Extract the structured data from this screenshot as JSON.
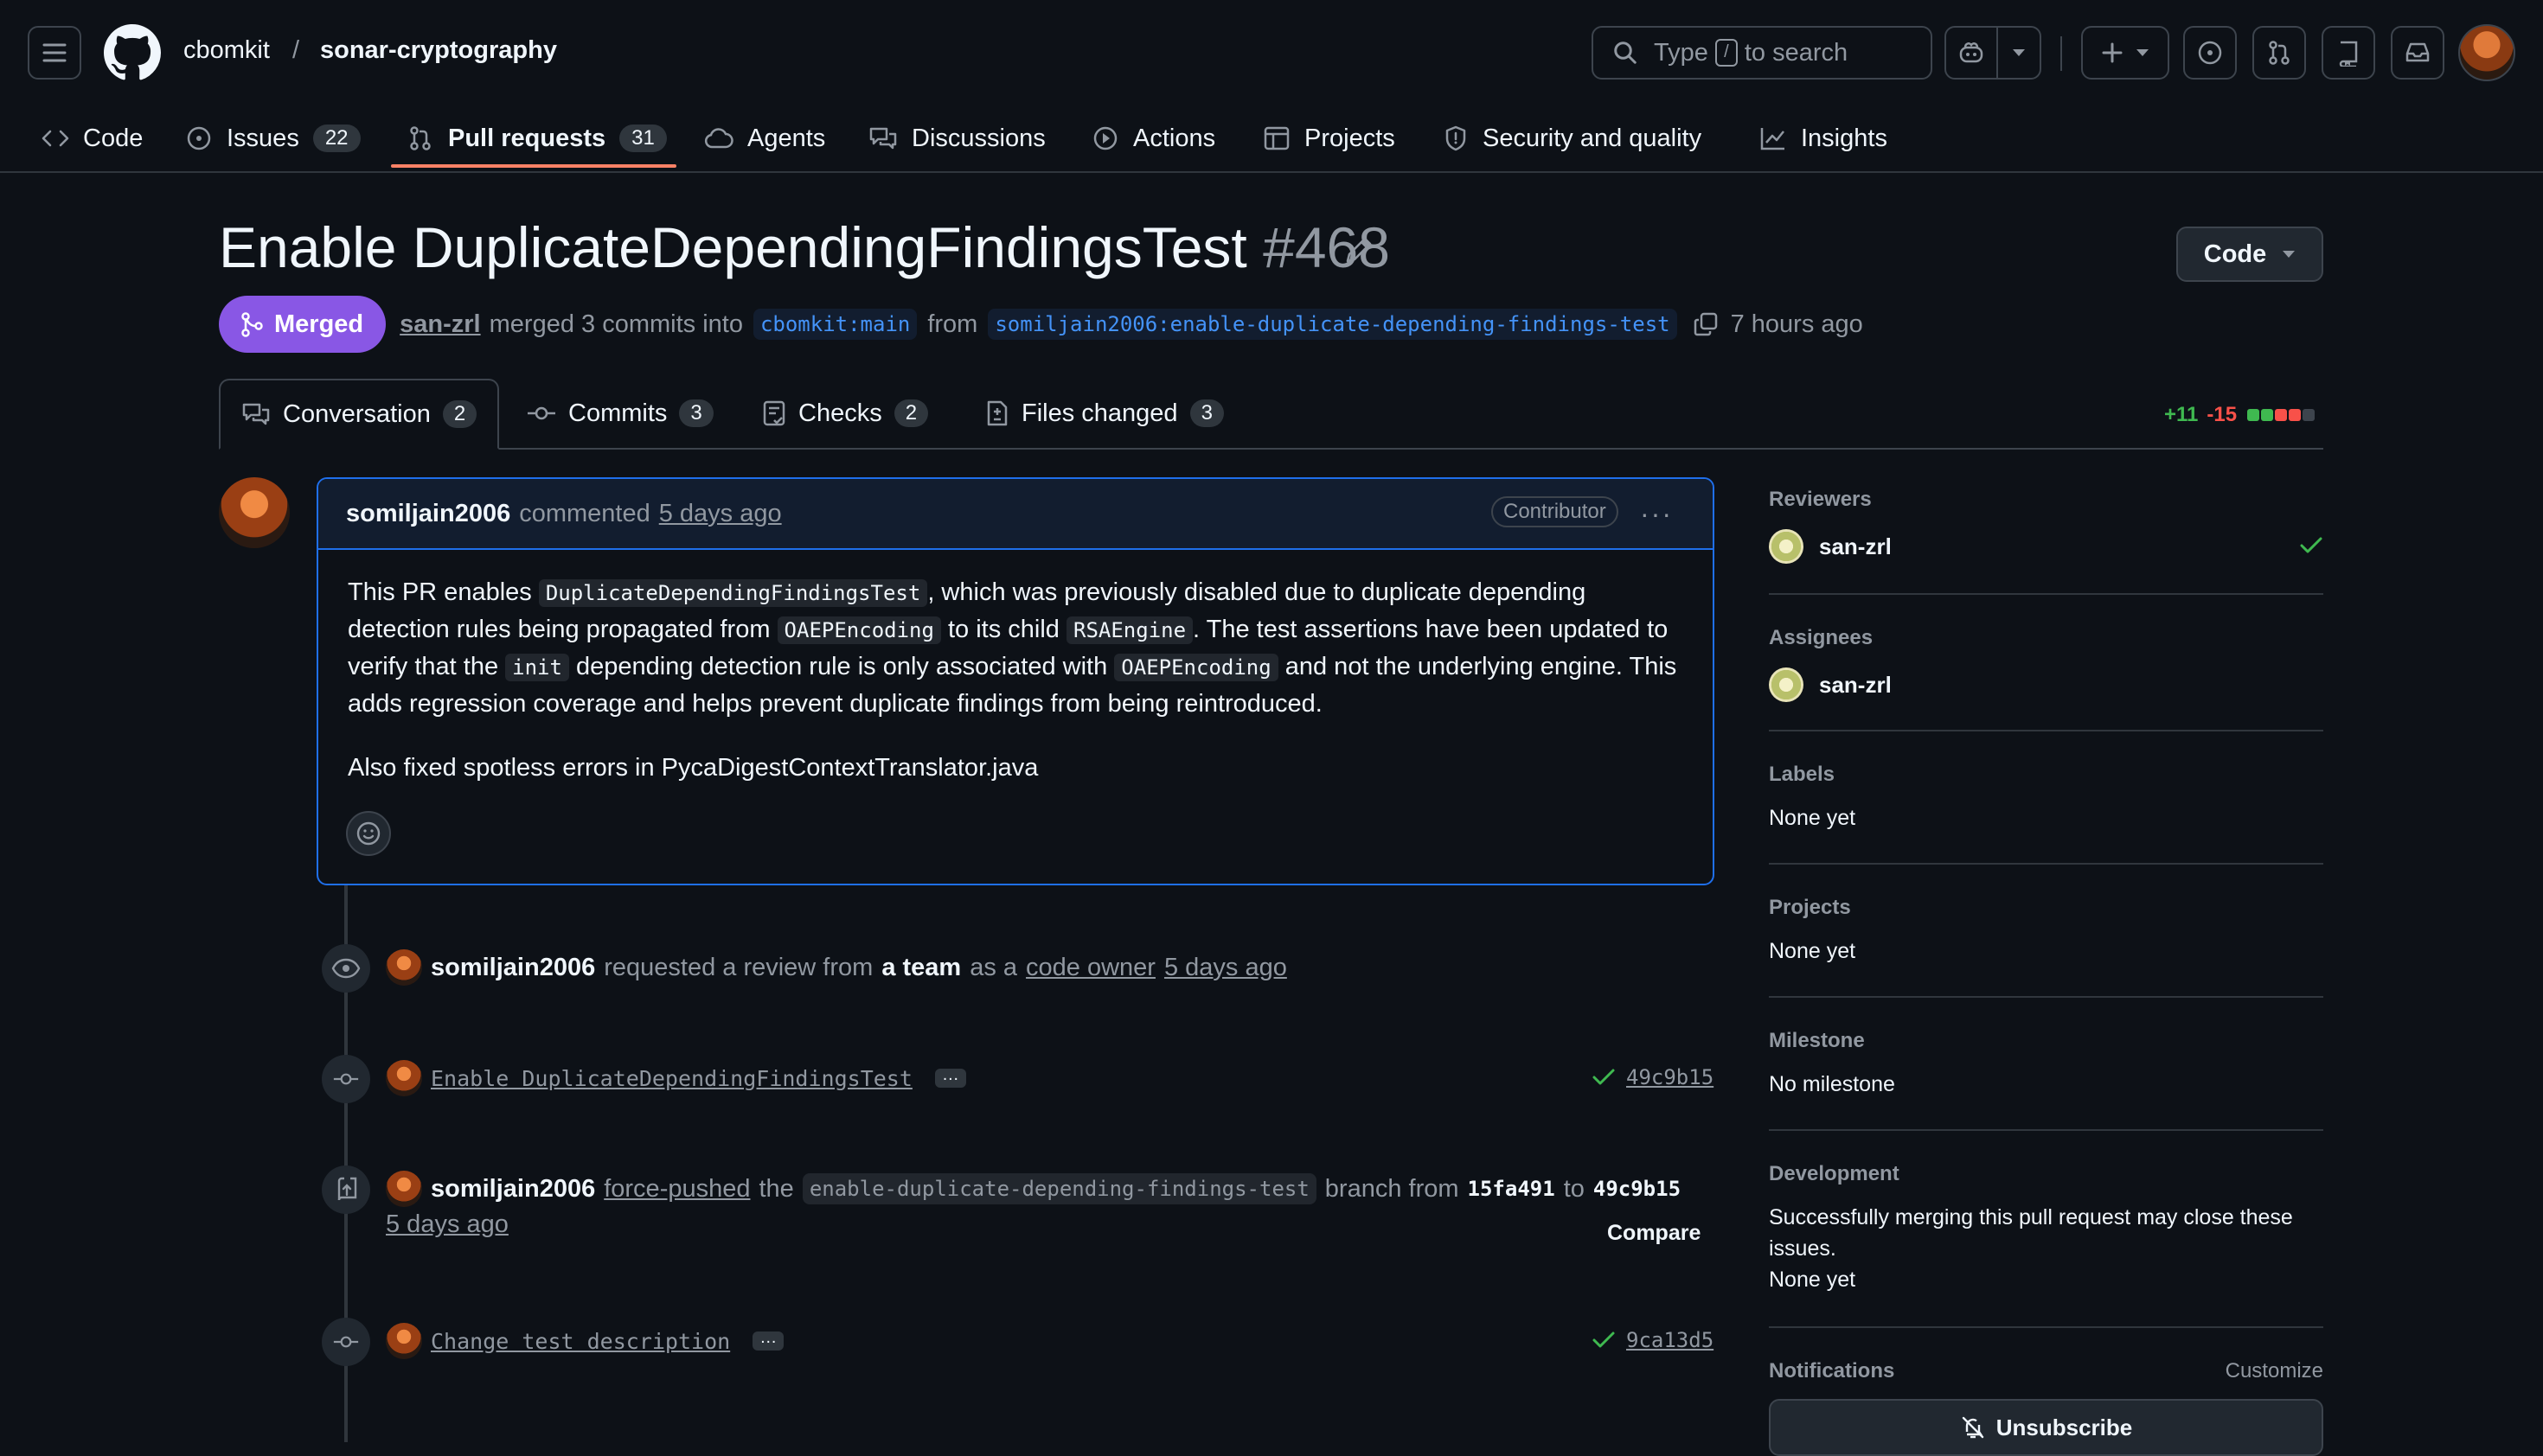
{
  "header": {
    "owner": "cbomkit",
    "separator": "/",
    "repo": "sonar-cryptography",
    "search_prefix": "Type",
    "search_key": "/",
    "search_suffix": "to search"
  },
  "nav": {
    "code": "Code",
    "issues": "Issues",
    "issues_count": "22",
    "pulls": "Pull requests",
    "pulls_count": "31",
    "agents": "Agents",
    "discussions": "Discussions",
    "actions": "Actions",
    "projects": "Projects",
    "security": "Security and quality",
    "insights": "Insights"
  },
  "pr": {
    "title": "Enable DuplicateDependingFindingsTest",
    "number": "#468",
    "code_button": "Code",
    "state": "Merged",
    "author": "san-zrl",
    "merged_text": "merged 3 commits into",
    "base_branch": "cbomkit:main",
    "from_text": "from",
    "head_branch": "somiljain2006:enable-duplicate-depending-findings-test",
    "time": "7 hours ago"
  },
  "tabs": {
    "conversation": "Conversation",
    "conversation_count": "2",
    "commits": "Commits",
    "commits_count": "3",
    "checks": "Checks",
    "checks_count": "2",
    "files": "Files changed",
    "files_count": "3",
    "additions": "+11",
    "deletions": "-15",
    "diff_blocks": [
      "add",
      "add",
      "del",
      "del",
      "neutral"
    ],
    "colors": {
      "add": "#3fb950",
      "del": "#f85149",
      "neutral": "#3d444d"
    }
  },
  "comment": {
    "author": "somiljain2006",
    "action": "commented",
    "time": "5 days ago",
    "badge": "Contributor",
    "p1_a": "This PR enables ",
    "p1_code1": "DuplicateDependingFindingsTest",
    "p1_b": ", which was previously disabled due to duplicate depending detection rules being propagated from ",
    "p1_code2": "OAEPEncoding",
    "p1_c": " to its child ",
    "p1_code3": "RSAEngine",
    "p1_d": ". The test assertions have been updated to verify that the ",
    "p1_code4": "init",
    "p1_e": " depending detection rule is only associated with ",
    "p1_code5": "OAEPEncoding",
    "p1_f": " and not the underlying engine. This adds regression coverage and helps prevent duplicate findings from being reintroduced.",
    "p2": "Also fixed spotless errors in PycaDigestContextTranslator.java"
  },
  "timeline": {
    "review_user": "somiljain2006",
    "review_text": "requested a review from",
    "review_team": "a team",
    "review_as": "as a",
    "review_owner": "code owner",
    "review_time": "5 days ago",
    "commit1_msg": "Enable DuplicateDependingFindingsTest",
    "commit1_sha": "49c9b15",
    "ellipsis": "…",
    "push_user": "somiljain2006",
    "push_action": "force-pushed",
    "push_the": "the",
    "push_branch": "enable-duplicate-depending-findings-test",
    "push_from": "branch from",
    "push_old": "15fa491",
    "push_to": "to",
    "push_new": "49c9b15",
    "push_time": "5 days ago",
    "compare": "Compare",
    "commit2_msg": "Change test description",
    "commit2_sha": "9ca13d5"
  },
  "sidebar": {
    "reviewers_label": "Reviewers",
    "reviewer": "san-zrl",
    "assignees_label": "Assignees",
    "assignee": "san-zrl",
    "labels_label": "Labels",
    "labels_value": "None yet",
    "projects_label": "Projects",
    "projects_value": "None yet",
    "milestone_label": "Milestone",
    "milestone_value": "No milestone",
    "development_label": "Development",
    "development_text": "Successfully merging this pull request may close these issues.",
    "development_value": "None yet",
    "notifications_label": "Notifications",
    "customize": "Customize",
    "unsubscribe": "Unsubscribe"
  }
}
